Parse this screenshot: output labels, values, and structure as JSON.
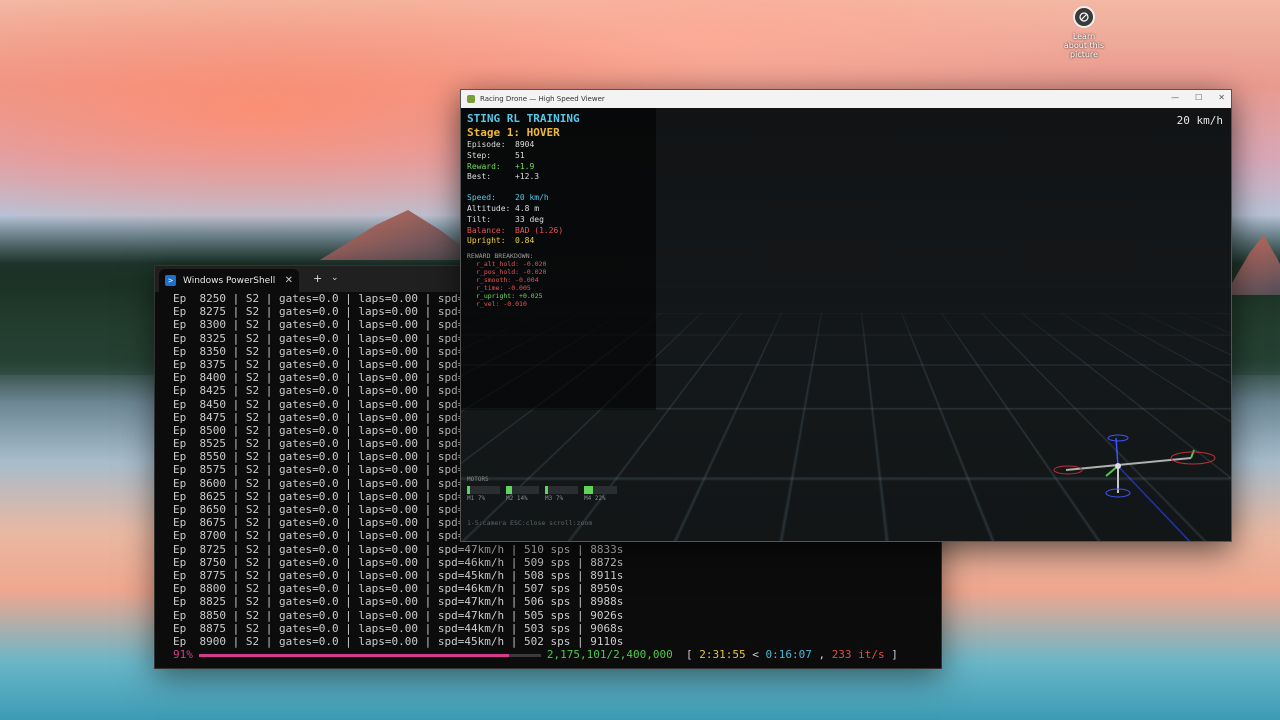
{
  "desktop": {
    "icon_label": "Learn about this picture"
  },
  "powershell": {
    "tab_title": "Windows PowerShell",
    "close_glyph": "✕",
    "new_tab_glyph": "+",
    "dropdown_glyph": "⌄",
    "lines": [
      "Ep  8250 | S2 | gates=0.0 | laps=0.00 | spd=",
      "Ep  8275 | S2 | gates=0.0 | laps=0.00 | spd=",
      "Ep  8300 | S2 | gates=0.0 | laps=0.00 | spd=",
      "Ep  8325 | S2 | gates=0.0 | laps=0.00 | spd=",
      "Ep  8350 | S2 | gates=0.0 | laps=0.00 | spd=",
      "Ep  8375 | S2 | gates=0.0 | laps=0.00 | spd=",
      "Ep  8400 | S2 | gates=0.0 | laps=0.00 | spd=",
      "Ep  8425 | S2 | gates=0.0 | laps=0.00 | spd=",
      "Ep  8450 | S2 | gates=0.0 | laps=0.00 | spd=",
      "Ep  8475 | S2 | gates=0.0 | laps=0.00 | spd=",
      "Ep  8500 | S2 | gates=0.0 | laps=0.00 | spd=",
      "Ep  8525 | S2 | gates=0.0 | laps=0.00 | spd=",
      "Ep  8550 | S2 | gates=0.0 | laps=0.00 | spd=",
      "Ep  8575 | S2 | gates=0.0 | laps=0.00 | spd=",
      "Ep  8600 | S2 | gates=0.0 | laps=0.00 | spd=",
      "Ep  8625 | S2 | gates=0.0 | laps=0.00 | spd=",
      "Ep  8650 | S2 | gates=0.0 | laps=0.00 | spd=",
      "Ep  8675 | S2 | gates=0.0 | laps=0.00 | spd=",
      "Ep  8700 | S2 | gates=0.0 | laps=0.00 | spd=",
      "Ep  8725 | S2 | gates=0.0 | laps=0.00 | spd=47km/h | 510 sps | 8833s",
      "Ep  8750 | S2 | gates=0.0 | laps=0.00 | spd=46km/h | 509 sps | 8872s",
      "Ep  8775 | S2 | gates=0.0 | laps=0.00 | spd=45km/h | 508 sps | 8911s",
      "Ep  8800 | S2 | gates=0.0 | laps=0.00 | spd=46km/h | 507 sps | 8950s",
      "Ep  8825 | S2 | gates=0.0 | laps=0.00 | spd=47km/h | 506 sps | 8988s",
      "Ep  8850 | S2 | gates=0.0 | laps=0.00 | spd=47km/h | 505 sps | 9026s",
      "Ep  8875 | S2 | gates=0.0 | laps=0.00 | spd=44km/h | 503 sps | 9068s",
      "Ep  8900 | S2 | gates=0.0 | laps=0.00 | spd=45km/h | 502 sps | 9110s"
    ],
    "progress": {
      "percent_text": "91%",
      "fraction": 0.906,
      "steps": "2,175,101/2,400,000",
      "open": "[",
      "elapsed": "2:31:55",
      "lt": "<",
      "remaining": "0:16:07",
      "comma": ",",
      "rate": "233 it/s",
      "close": "]"
    }
  },
  "viewer": {
    "window_title": "Racing Drone — High Speed Viewer",
    "speed_corner": "20 km/h",
    "hud": {
      "title": "STING RL TRAINING",
      "stage": "Stage 1: HOVER",
      "episode_label": "Episode:",
      "episode_value": "8904",
      "step_label": "Step:",
      "step_value": "51",
      "reward_label": "Reward:",
      "reward_value": "+1.9",
      "best_label": "Best:",
      "best_value": "+12.3",
      "speed_label": "Speed:",
      "speed_value": "20 km/h",
      "altitude_label": "Altitude:",
      "altitude_value": "4.8 m",
      "tilt_label": "Tilt:",
      "tilt_value": "33 deg",
      "balance_label": "Balance:",
      "balance_value": "BAD (1.26)",
      "upright_label": "Upright:",
      "upright_value": "0.84",
      "breakdown_header": "REWARD BREAKDOWN:",
      "breakdown": [
        "r_alt_hold: -0.020",
        "r_pos_hold: -0.020",
        "r_smooth: -0.004",
        "r_time: -0.005",
        "r_upright: +0.025",
        "r_vel: -0.010"
      ]
    },
    "motors": {
      "header": "MOTORS",
      "items": [
        {
          "label": "M1 7%",
          "level": 0.07
        },
        {
          "label": "M2 14%",
          "level": 0.14
        },
        {
          "label": "M3 7%",
          "level": 0.07
        },
        {
          "label": "M4 22%",
          "level": 0.22
        }
      ]
    },
    "keys_hint": "1-5:camera  ESC:close  scroll:zoom"
  },
  "colors": {
    "accent_pink": "#d63a8a",
    "green": "#6fdc5a",
    "cyan": "#56c8e8",
    "orange": "#f0b93a",
    "red": "#e8545a"
  }
}
